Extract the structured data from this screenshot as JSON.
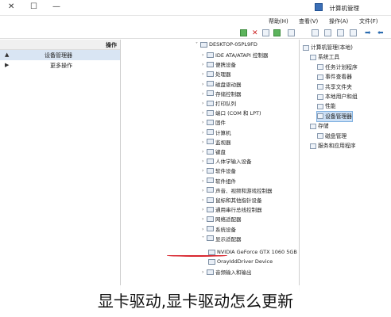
{
  "window": {
    "title": "计算机管理",
    "controls": [
      "—",
      "☐",
      "✕"
    ]
  },
  "menu": [
    "文件(F)",
    "操作(A)",
    "查看(V)",
    "帮助(H)"
  ],
  "left_panel": {
    "header": "操作",
    "items": [
      {
        "label": "设备管理器",
        "selected": true,
        "arrow": "▲"
      },
      {
        "label": "更多操作",
        "selected": false,
        "arrow": "▶"
      }
    ]
  },
  "device_tree": {
    "root": "DESKTOP-05PL9FD",
    "categories": [
      "IDE ATA/ATAPI 控制器",
      "便携设备",
      "处理器",
      "磁盘驱动器",
      "存储控制器",
      "打印队列",
      "端口 (COM 和 LPT)",
      "固件",
      "计算机",
      "监视器",
      "键盘",
      "人体学输入设备",
      "软件设备",
      "软件组件",
      "声音、视频和游戏控制器",
      "鼠标和其他指针设备",
      "通用串行总线控制器",
      "网络适配器",
      "系统设备",
      "显示适配器"
    ],
    "display_adapters": [
      "NVIDIA GeForce GTX 1060 5GB",
      "OrayIddDriver Device"
    ],
    "last_category": "音频输入和输出"
  },
  "right_panel": {
    "items": [
      {
        "label": "计算机管理(本地)",
        "level": 0
      },
      {
        "label": "系统工具",
        "level": 1
      },
      {
        "label": "任务计划程序",
        "level": 2
      },
      {
        "label": "事件查看器",
        "level": 2
      },
      {
        "label": "共享文件夹",
        "level": 2
      },
      {
        "label": "本地用户和组",
        "level": 2
      },
      {
        "label": "性能",
        "level": 2
      },
      {
        "label": "设备管理器",
        "level": 2,
        "selected": true
      },
      {
        "label": "存储",
        "level": 1
      },
      {
        "label": "磁盘管理",
        "level": 2
      },
      {
        "label": "服务和应用程序",
        "level": 1
      }
    ]
  },
  "caption": "显卡驱动,显卡驱动怎么更新",
  "colors": {
    "selection": "#d9e5f3",
    "highlight_underline": "#d8262f"
  }
}
